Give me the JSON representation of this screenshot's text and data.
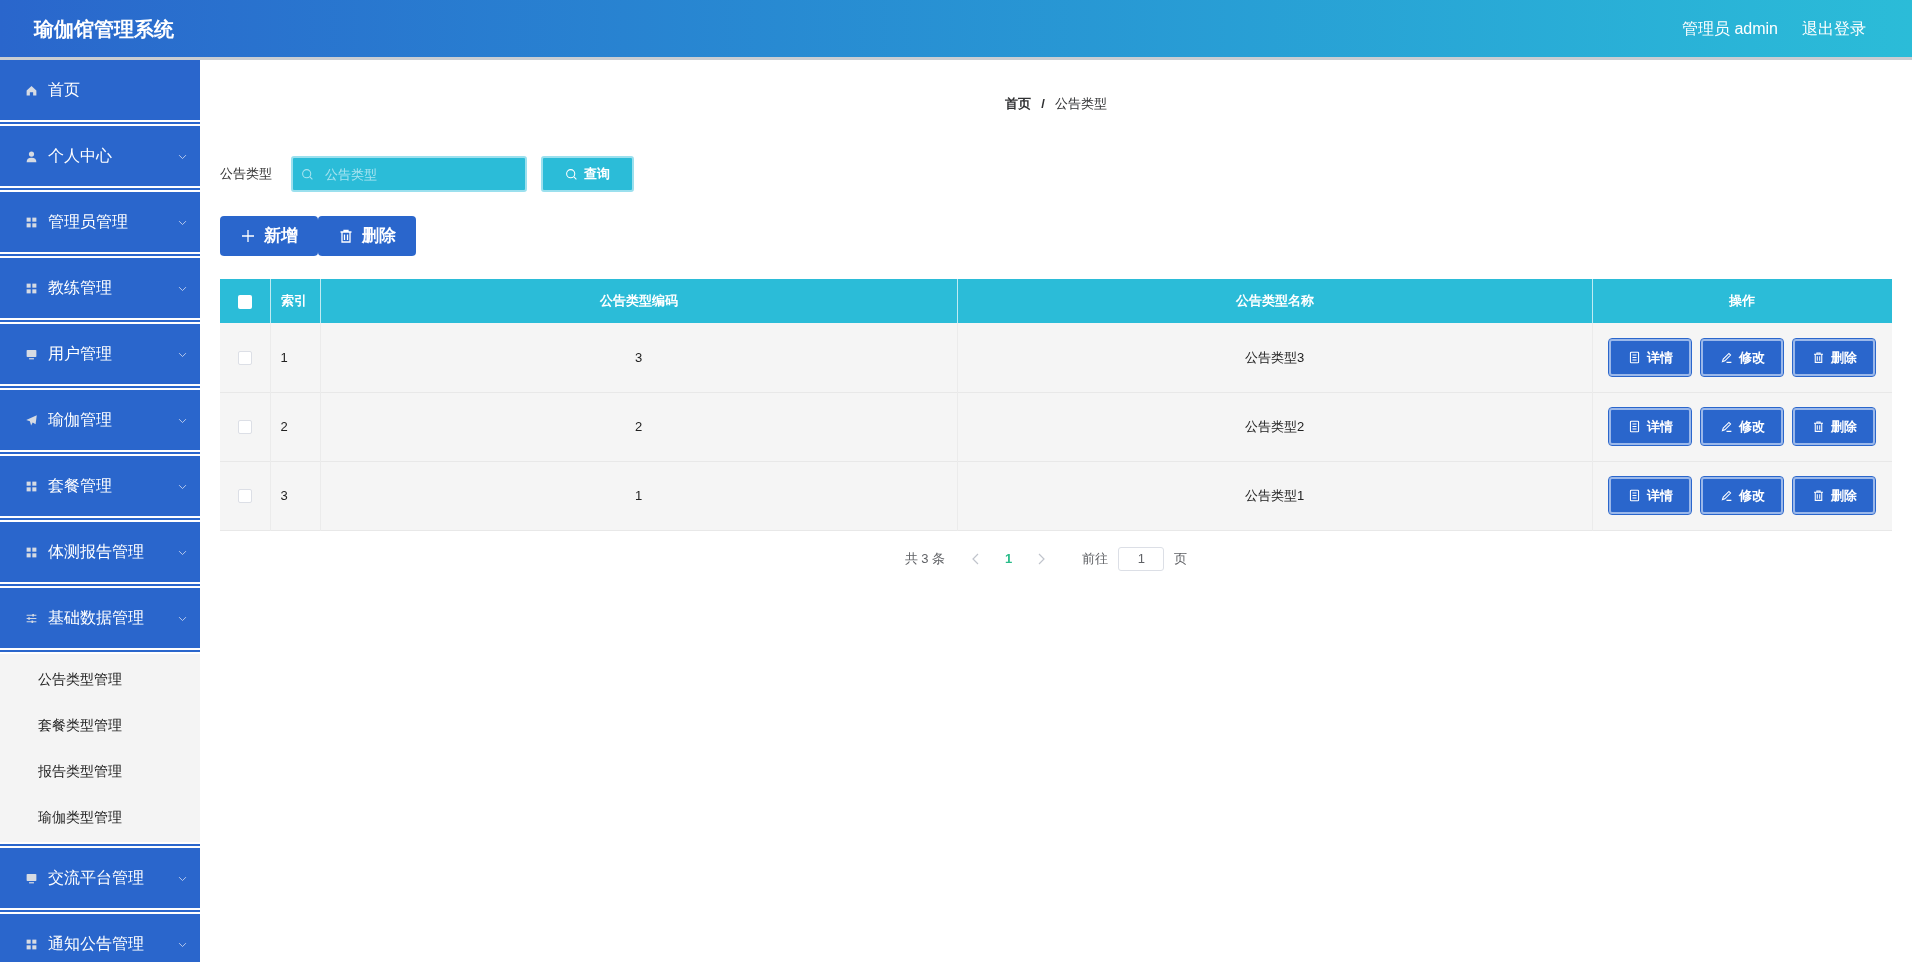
{
  "header": {
    "title": "瑜伽馆管理系统",
    "user": "管理员 admin",
    "logout": "退出登录"
  },
  "sidebar": {
    "items": [
      {
        "label": "首页",
        "expandable": false,
        "expanded": false
      },
      {
        "label": "个人中心",
        "expandable": true,
        "expanded": false
      },
      {
        "label": "管理员管理",
        "expandable": true,
        "expanded": false
      },
      {
        "label": "教练管理",
        "expandable": true,
        "expanded": false
      },
      {
        "label": "用户管理",
        "expandable": true,
        "expanded": false
      },
      {
        "label": "瑜伽管理",
        "expandable": true,
        "expanded": false
      },
      {
        "label": "套餐管理",
        "expandable": true,
        "expanded": false
      },
      {
        "label": "体测报告管理",
        "expandable": true,
        "expanded": false
      },
      {
        "label": "基础数据管理",
        "expandable": true,
        "expanded": true,
        "children": [
          {
            "label": "公告类型管理"
          },
          {
            "label": "套餐类型管理"
          },
          {
            "label": "报告类型管理"
          },
          {
            "label": "瑜伽类型管理"
          }
        ]
      },
      {
        "label": "交流平台管理",
        "expandable": true,
        "expanded": false
      },
      {
        "label": "通知公告管理",
        "expandable": true,
        "expanded": false
      }
    ]
  },
  "breadcrumb": [
    "首页",
    "公告类型"
  ],
  "breadcrumb_separator": "/",
  "search": {
    "label": "公告类型",
    "placeholder": "公告类型",
    "button": "查询"
  },
  "toolbar": [
    "新增",
    "删除"
  ],
  "table": {
    "select_all": {
      "checked": false
    },
    "columns": [
      "索引",
      "公告类型编码",
      "公告类型名称",
      "操作"
    ],
    "rows": [
      {
        "checked": false,
        "cells": [
          "1",
          "3",
          "公告类型3"
        ],
        "actions": [
          "详情",
          "修改",
          "删除"
        ]
      },
      {
        "checked": false,
        "cells": [
          "2",
          "2",
          "公告类型2"
        ],
        "actions": [
          "详情",
          "修改",
          "删除"
        ]
      },
      {
        "checked": false,
        "cells": [
          "3",
          "1",
          "公告类型1"
        ],
        "actions": [
          "详情",
          "修改",
          "删除"
        ]
      }
    ]
  },
  "pagination": {
    "total": "共 3 条",
    "pages": [
      {
        "label": "1",
        "selected": true
      }
    ],
    "goto_label": "前往",
    "goto_value": "1",
    "goto_suffix": "页"
  }
}
